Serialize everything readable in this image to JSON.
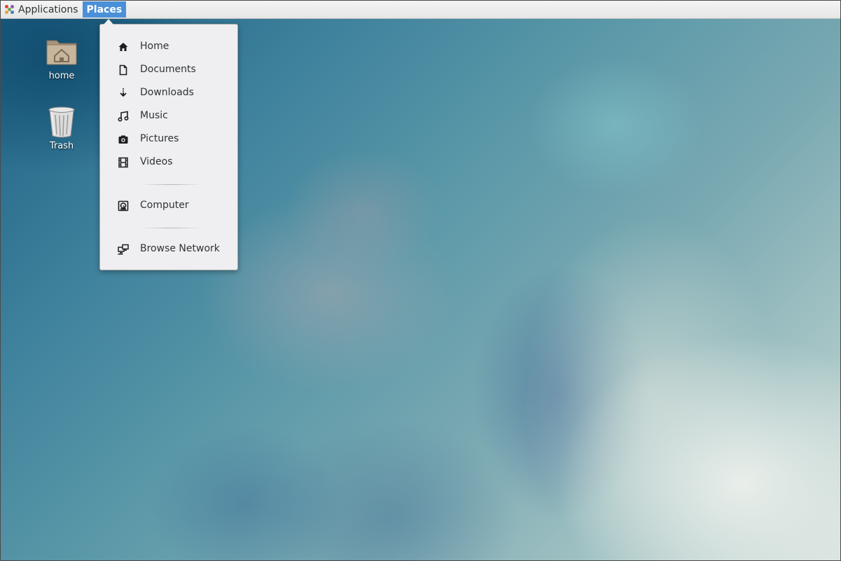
{
  "top_panel": {
    "applications_label": "Applications",
    "places_label": "Places"
  },
  "places_menu": {
    "items": [
      {
        "label": "Home",
        "icon": "home-icon"
      },
      {
        "label": "Documents",
        "icon": "document-icon"
      },
      {
        "label": "Downloads",
        "icon": "download-icon"
      },
      {
        "label": "Music",
        "icon": "music-icon"
      },
      {
        "label": "Pictures",
        "icon": "camera-icon"
      },
      {
        "label": "Videos",
        "icon": "film-icon"
      },
      {
        "label": "Computer",
        "icon": "computer-icon"
      },
      {
        "label": "Browse Network",
        "icon": "network-icon"
      }
    ]
  },
  "desktop": {
    "icons": [
      {
        "label": "home",
        "icon": "home-folder-icon"
      },
      {
        "label": "Trash",
        "icon": "trash-icon"
      }
    ]
  },
  "colors": {
    "panel_background": "#eaeaea",
    "active_menu": "#4a90d9",
    "menu_background": "#efeef1"
  }
}
